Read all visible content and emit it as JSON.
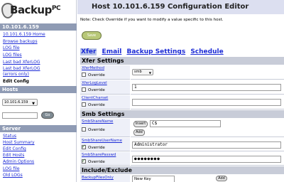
{
  "sidebar": {
    "logo_main": "ackup",
    "logo_pc": "PC",
    "host_header": "10.101.6.159",
    "host_links": [
      "10.101.6.159 Home",
      "Browse backups",
      "LOG file",
      "LOG files",
      "Last bad XferLOG",
      "Last bad XferLOG (errors only)",
      "Edit Config"
    ],
    "hosts_header": "Hosts",
    "host_select_value": "10.101.6.159",
    "go_label": "Go",
    "server_header": "Server",
    "server_links": [
      "Status",
      "Host Summary",
      "Edit Config",
      "Edit Hosts",
      "Admin Options",
      "LOG file",
      "Old LOGs"
    ]
  },
  "main": {
    "title": "Host 10.101.6.159 Configuration Editor",
    "note": "Note: Check Override if you want to modify a value specific to this host.",
    "save_label": "Save",
    "tabs": [
      "Xfer",
      "Email",
      "Backup Settings",
      "Schedule"
    ],
    "override_label": "Override",
    "sections": {
      "xfer": "Xfer Settings",
      "smb": "Smb Settings",
      "include": "Include/Exclude"
    },
    "fields": {
      "xfer_method": {
        "label": "XferMethod",
        "value": "smb"
      },
      "xfer_log_level": {
        "label": "XferLogLevel",
        "value": "1"
      },
      "client_charset": {
        "label": "ClientCharset",
        "value": ""
      },
      "smb_share_name": {
        "label": "SmbShareName",
        "insert_label": "Insert",
        "add_label": "Add",
        "value": "C$"
      },
      "smb_share_user": {
        "label": "SmbShareUserName",
        "value": "Administrator"
      },
      "smb_share_passwd": {
        "label": "SmbSharePasswd",
        "value": "●●●●●●●●"
      },
      "backup_files_only": {
        "label": "BackupFilesOnly",
        "new_key_label": "New Key",
        "add_label": "Add"
      }
    }
  },
  "colors": {
    "sidebar_header": "#8f9bb4",
    "title_bg": "#dcdff0",
    "link": "#1c2bd6",
    "save_button": "#b8c878"
  }
}
